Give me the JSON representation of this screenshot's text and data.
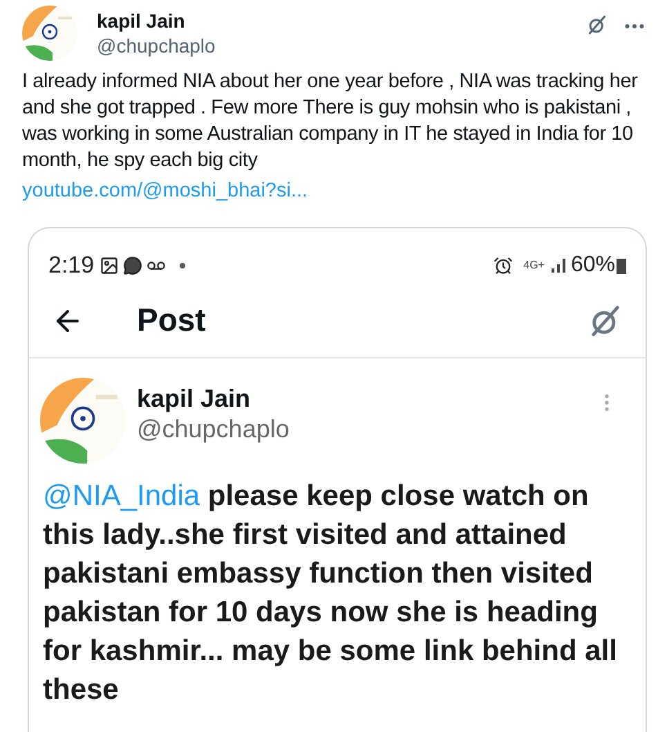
{
  "tweet": {
    "name": "kapil Jain",
    "handle": "@chupchaplo",
    "text": "I already informed NIA about her one year before , NIA was tracking her and she got trapped . Few more There is guy mohsin who is pakistani , was working in some Australian company in IT he stayed in India for 10 month,  he spy each big city",
    "link": "youtube.com/@moshi_bhai?si..."
  },
  "screenshot": {
    "status_bar": {
      "time": "2:19",
      "network": "4G+",
      "battery": "60%"
    },
    "header": {
      "title": "Post"
    },
    "post": {
      "name": "kapil Jain",
      "handle": "@chupchaplo",
      "mention": "@NIA_India",
      "text": " please keep close watch on this lady..she first visited and attained pakistani embassy function then visited pakistan for 10 days now she is heading for kashmir... may be some link behind all these"
    }
  }
}
